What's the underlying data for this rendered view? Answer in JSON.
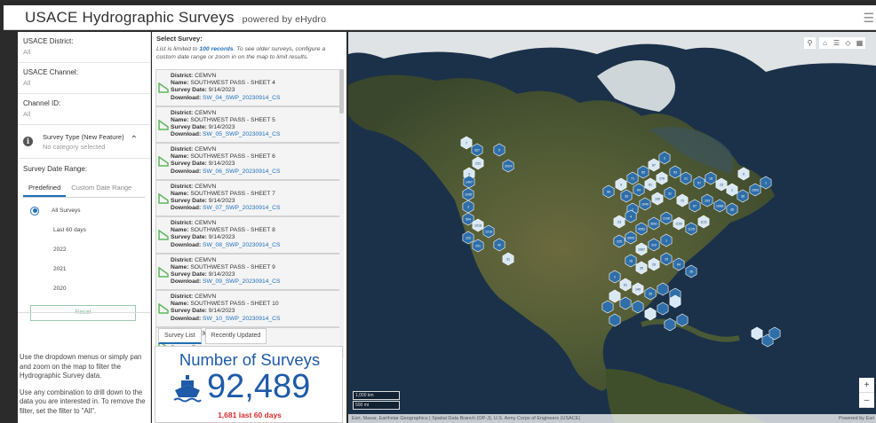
{
  "header": {
    "title": "USACE Hydrographic Surveys",
    "powered": "powered by eHydro",
    "menu_icon": "hamburger-icon"
  },
  "filters": {
    "district": {
      "label": "USACE District:",
      "value": "All"
    },
    "channel": {
      "label": "USACE Channel:",
      "value": "All"
    },
    "channel_id": {
      "label": "Channel ID:",
      "value": "All"
    },
    "survey_type": {
      "label": "Survey Type (New Feature)",
      "value": "No category selected"
    },
    "date_range": {
      "label": "Survey Date Range:",
      "tabs": [
        "Predefined",
        "Custom Date Range"
      ],
      "options": [
        "All Surveys",
        "Last 60 days",
        "2022",
        "2021",
        "2020"
      ],
      "selected": "All Surveys"
    },
    "reset_label": "Reset"
  },
  "help": {
    "p1": "Use the dropdown menus or simply pan and zoom on the map to filter the Hydrographic Survey data.",
    "p2": "Use any combination to drill down to the data you are interested in.  To remove the filter, set the filter to \"All\"."
  },
  "survey_list": {
    "heading": "Select Survey:",
    "note_pre": "List is limited to ",
    "note_bold": "100 records",
    "note_post": ".  To see older surveys, configure a custom date range or zoom in on the map to limit results.",
    "field_labels": {
      "district": "District:",
      "name": "Name:",
      "date": "Survey Date:",
      "download": "Download:"
    },
    "items": [
      {
        "district": "CEMVN",
        "name": "SOUTHWEST PASS - SHEET 4",
        "date": "9/14/2023",
        "download": "SW_04_SWP_20230914_CS"
      },
      {
        "district": "CEMVN",
        "name": "SOUTHWEST PASS - SHEET 5",
        "date": "9/14/2023",
        "download": "SW_05_SWP_20230914_CS"
      },
      {
        "district": "CEMVN",
        "name": "SOUTHWEST PASS - SHEET 6",
        "date": "9/14/2023",
        "download": "SW_06_SWP_20230914_CS"
      },
      {
        "district": "CEMVN",
        "name": "SOUTHWEST PASS - SHEET 7",
        "date": "9/14/2023",
        "download": "SW_07_SWP_20230914_CS"
      },
      {
        "district": "CEMVN",
        "name": "SOUTHWEST PASS - SHEET 8",
        "date": "9/14/2023",
        "download": "SW_08_SWP_20230914_CS"
      },
      {
        "district": "CEMVN",
        "name": "SOUTHWEST PASS - SHEET 9",
        "date": "9/14/2023",
        "download": "SW_09_SWP_20230914_CS"
      },
      {
        "district": "CEMVN",
        "name": "SOUTHWEST PASS - SHEET 10",
        "date": "9/14/2023",
        "download": "SW_10_SWP_20230914_CS"
      },
      {
        "district": "CEMVN",
        "name": "",
        "date": "",
        "download": ""
      }
    ],
    "tabs": [
      "Survey List",
      "Recently Updated"
    ],
    "shape_color": "#5cb85c"
  },
  "counter": {
    "title": "Number of Surveys",
    "value": "92,489",
    "last": "1,681 last 60 days",
    "icon": "ship-icon",
    "color": "#1e5aa8",
    "last_color": "#d62b2b"
  },
  "map": {
    "tools": [
      "search-icon",
      "home-icon",
      "list-icon",
      "layers-icon",
      "basemap-gallery-icon"
    ],
    "zoom_in": "+",
    "zoom_out": "–",
    "scale": [
      "1,000 km",
      "500 mi"
    ],
    "attribution": "Esri, Maxar, Earthstar Geographics | Spatial Data Branch (OP-J), U.S. Army Corps of Engineers (USACE)",
    "powered": "Powered by Esri",
    "hex_color_dark": "#2f6ea8",
    "hex_color_light": "#d8e8f4",
    "hex_labels": [
      "7",
      "327",
      "5",
      "231",
      "2024",
      "3",
      "1407",
      "1245",
      "3",
      "504",
      "1018",
      "122",
      "1218",
      "201",
      "42",
      "31",
      "99",
      "9",
      "71",
      "65",
      "87",
      "2",
      "39",
      "64",
      "61",
      "176",
      "59",
      "21",
      "57",
      "18",
      "23",
      "1",
      "36",
      "1503",
      "1",
      "9",
      "1",
      "1040",
      "100",
      "31",
      "72",
      "57",
      "103",
      "1098",
      "36",
      "23",
      "4",
      "4352",
      "3691",
      "2108",
      "1150",
      "1125",
      "1121",
      "225",
      "3093",
      "1687",
      "310",
      "1",
      "15",
      "35",
      "29",
      "15",
      "64",
      "26",
      "2",
      "61",
      "140",
      "35"
    ]
  }
}
